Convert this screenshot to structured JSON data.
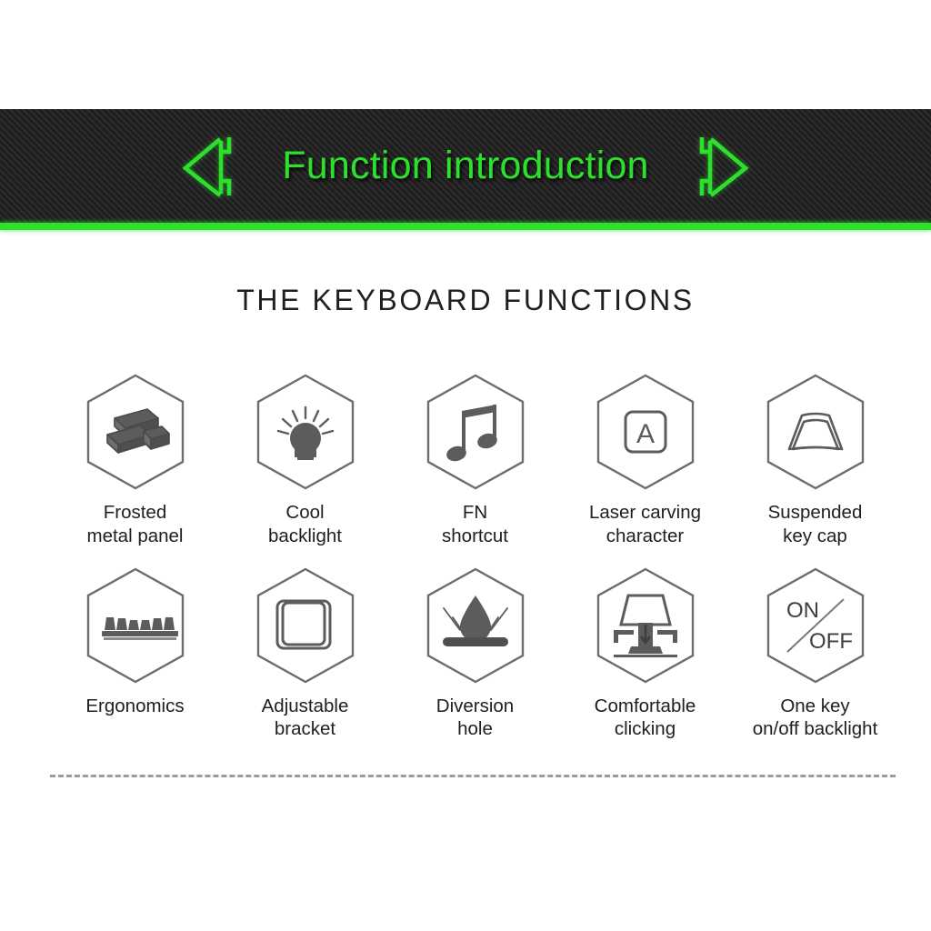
{
  "banner": {
    "title": "Function introduction",
    "left_arrow_icon": "double-chevron-left-icon",
    "right_arrow_icon": "double-chevron-right-icon",
    "background_color": "#262626",
    "accent_color": "#2ee02e"
  },
  "section": {
    "title": "THE KEYBOARD FUNCTIONS"
  },
  "features": {
    "row1": [
      {
        "id": "frosted-metal-panel",
        "icon": "metal-ingots-icon",
        "label": "Frosted\nmetal panel"
      },
      {
        "id": "cool-backlight",
        "icon": "light-bulb-icon",
        "label": "Cool\nbacklight"
      },
      {
        "id": "fn-shortcut",
        "icon": "music-note-icon",
        "label": "FN\nshortcut"
      },
      {
        "id": "laser-carving-character",
        "icon": "keycap-letter-a-icon",
        "label": "Laser carving\ncharacter"
      },
      {
        "id": "suspended-key-cap",
        "icon": "trapezoid-keycap-icon",
        "label": "Suspended\nkey cap"
      }
    ],
    "row2": [
      {
        "id": "ergonomics",
        "icon": "key-row-profile-icon",
        "label": "Ergonomics"
      },
      {
        "id": "adjustable-bracket",
        "icon": "nested-squares-bracket-icon",
        "label": "Adjustable\nbracket"
      },
      {
        "id": "diversion-hole",
        "icon": "water-droplet-icon",
        "label": "Diversion\nhole"
      },
      {
        "id": "comfortable-clicking",
        "icon": "key-press-arrow-icon",
        "label": "Comfortable\nclicking"
      },
      {
        "id": "one-key-backlight",
        "icon": "on-off-toggle-icon",
        "label": "One key\non/off backlight"
      }
    ]
  },
  "icon_text": {
    "keycap_letter": "A",
    "on_label": "ON",
    "off_label": "OFF"
  },
  "divider": {
    "style": "dashed",
    "color": "#9b9b9b"
  }
}
